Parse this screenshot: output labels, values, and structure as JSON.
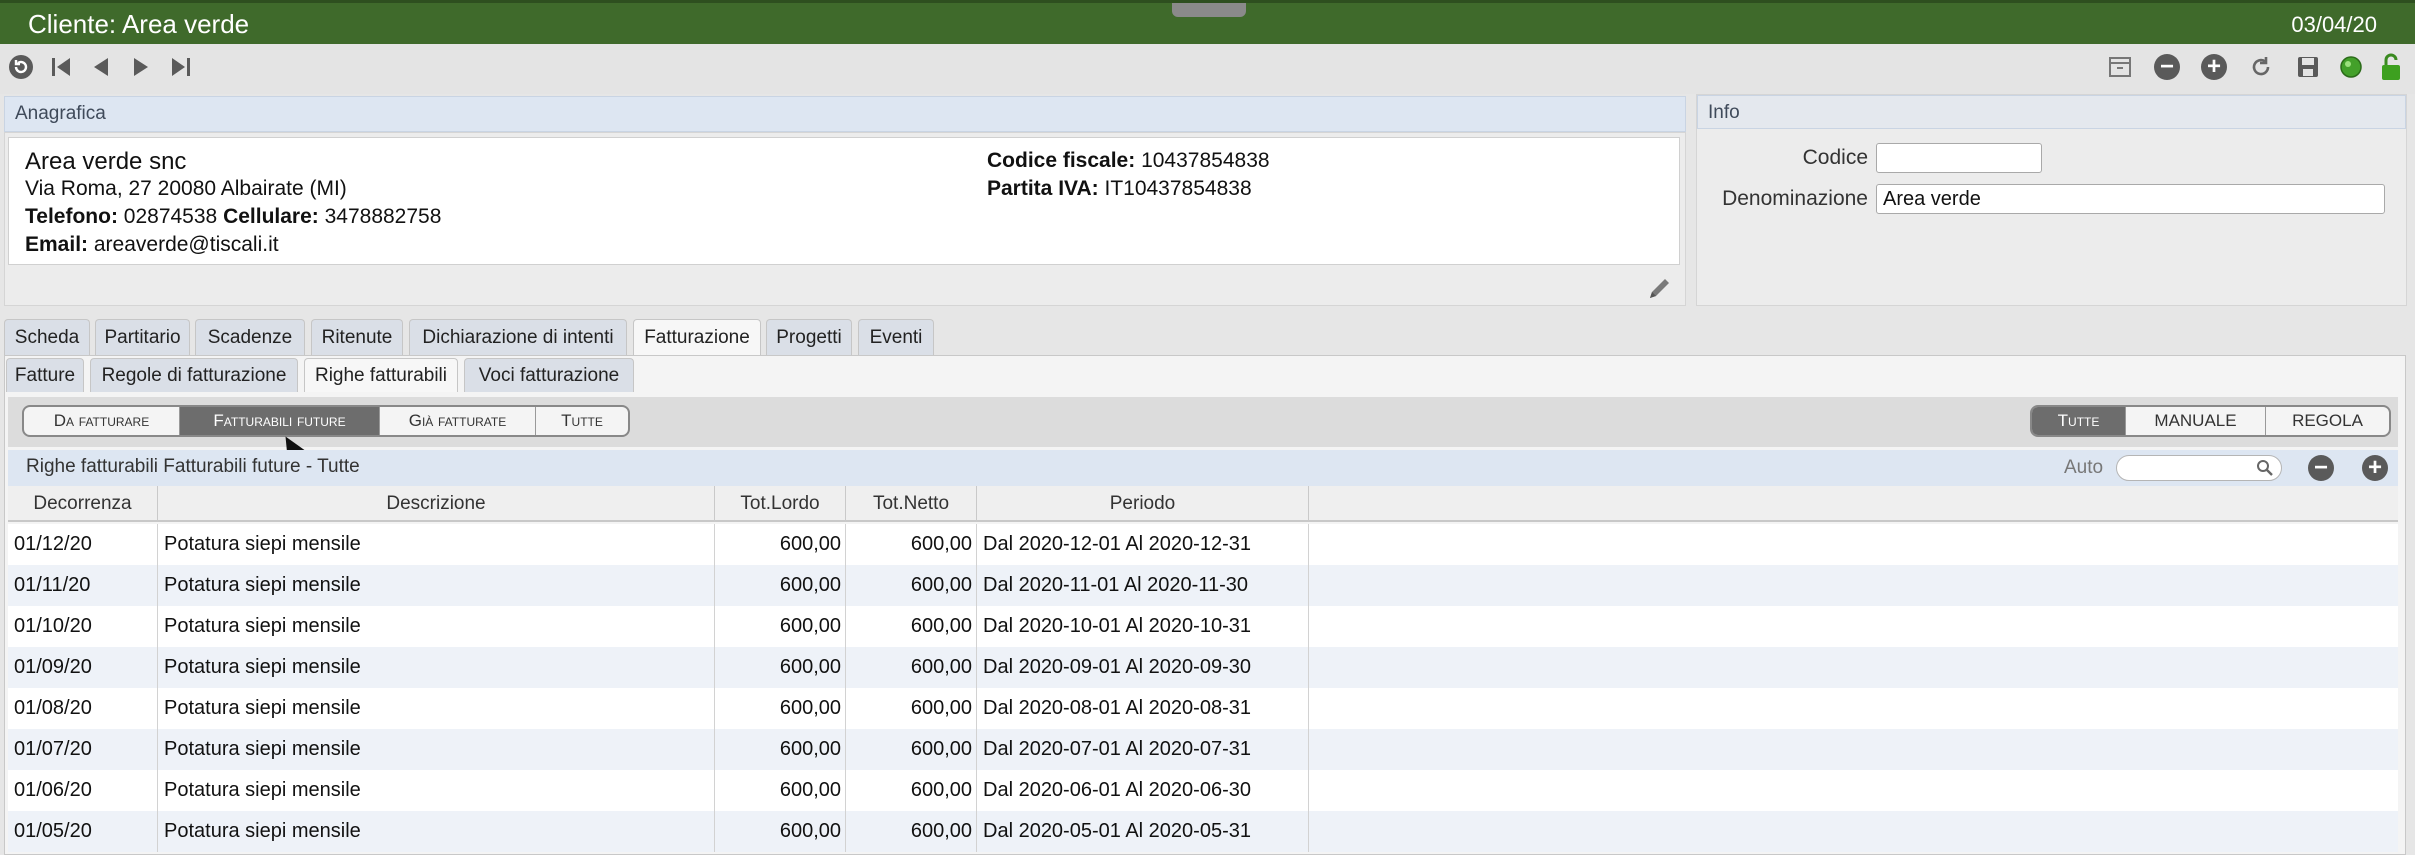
{
  "window": {
    "title": "Cliente: Area verde",
    "date": "03/04/20"
  },
  "toolbar": {
    "left_icons": [
      "refresh-icon",
      "first-record-icon",
      "previous-icon",
      "next-icon",
      "last-record-icon"
    ],
    "right_icons": [
      "archive-icon",
      "remove-icon",
      "add-icon",
      "undo-icon",
      "save-icon",
      "status-green-icon",
      "unlock-icon"
    ]
  },
  "anagrafica": {
    "header": "Anagrafica",
    "name": "Area verde snc",
    "address": "Via Roma, 27 20080 Albairate (MI)",
    "phone_label": "Telefono:",
    "phone": "02874538",
    "mobile_label": "Cellulare:",
    "mobile": "3478882758",
    "email_label": "Email:",
    "email": "areaverde@tiscali.it",
    "cf_label": "Codice fiscale:",
    "cf": "10437854838",
    "piva_label": "Partita IVA:",
    "piva": "IT10437854838"
  },
  "info": {
    "header": "Info",
    "codice_label": "Codice",
    "codice_value": "",
    "denominazione_label": "Denominazione",
    "denominazione_value": "Area verde"
  },
  "main_tabs": [
    "Scheda",
    "Partitario",
    "Scadenze",
    "Ritenute",
    "Dichiarazione di intenti",
    "Fatturazione",
    "Progetti",
    "Eventi"
  ],
  "sub_tabs": [
    "Fatture",
    "Regole di fatturazione",
    "Righe fatturabili",
    "Voci fatturazione"
  ],
  "filter_left": [
    "Da fatturare",
    "Fatturabili future",
    "Già fatturate",
    "Tutte"
  ],
  "filter_right": [
    "Tutte",
    "MANUALE",
    "REGOLA"
  ],
  "list": {
    "title": "Righe fatturabili Fatturabili future - Tutte",
    "search_label": "Auto",
    "search_value": ""
  },
  "table": {
    "columns": [
      "Decorrenza",
      "Descrizione",
      "Tot.Lordo",
      "Tot.Netto",
      "Periodo"
    ],
    "rows": [
      [
        "01/12/20",
        "Potatura siepi mensile",
        "600,00",
        "600,00",
        "Dal 2020-12-01 Al 2020-12-31"
      ],
      [
        "01/11/20",
        "Potatura siepi mensile",
        "600,00",
        "600,00",
        "Dal 2020-11-01 Al 2020-11-30"
      ],
      [
        "01/10/20",
        "Potatura siepi mensile",
        "600,00",
        "600,00",
        "Dal 2020-10-01 Al 2020-10-31"
      ],
      [
        "01/09/20",
        "Potatura siepi mensile",
        "600,00",
        "600,00",
        "Dal 2020-09-01 Al 2020-09-30"
      ],
      [
        "01/08/20",
        "Potatura siepi mensile",
        "600,00",
        "600,00",
        "Dal 2020-08-01 Al 2020-08-31"
      ],
      [
        "01/07/20",
        "Potatura siepi mensile",
        "600,00",
        "600,00",
        "Dal 2020-07-01 Al 2020-07-31"
      ],
      [
        "01/06/20",
        "Potatura siepi mensile",
        "600,00",
        "600,00",
        "Dal 2020-06-01 Al 2020-06-30"
      ],
      [
        "01/05/20",
        "Potatura siepi mensile",
        "600,00",
        "600,00",
        "Dal 2020-05-01 Al 2020-05-31"
      ]
    ]
  },
  "colors": {
    "titlebar": "#3f6a2b",
    "header_blue": "#dde6f2",
    "active_segment": "#6d6d6d"
  }
}
